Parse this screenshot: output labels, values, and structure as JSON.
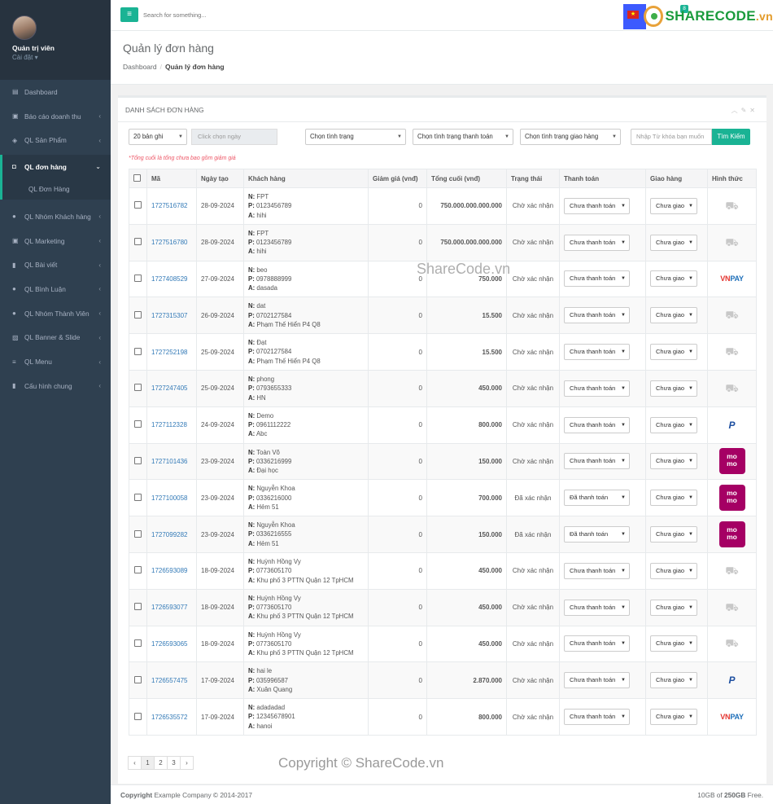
{
  "user": {
    "name": "Quản trị viên",
    "settings_label": "Cài đặt"
  },
  "sidebar": {
    "items": [
      {
        "icon": "table-icon",
        "label": "Dashboard"
      },
      {
        "icon": "money-icon",
        "label": "Báo cáo doanh thu"
      },
      {
        "icon": "cube-icon",
        "label": "QL Sản Phẩm"
      },
      {
        "icon": "shopping-bag-icon",
        "label": "QL đơn hàng"
      },
      {
        "icon": "user-icon",
        "label": "QL Nhóm Khách hàng"
      },
      {
        "icon": "money-icon",
        "label": "QL Marketing"
      },
      {
        "icon": "file-icon",
        "label": "QL Bài viết"
      },
      {
        "icon": "comment-icon",
        "label": "QL Bình Luận"
      },
      {
        "icon": "user-icon",
        "label": "QL Nhóm Thành Viên"
      },
      {
        "icon": "image-icon",
        "label": "QL Banner & Slide"
      },
      {
        "icon": "bars-icon",
        "label": "QL Menu"
      },
      {
        "icon": "file-icon",
        "label": "Cấu hình chung"
      }
    ],
    "sub_item": "QL Đơn Hàng"
  },
  "topbar": {
    "search_placeholder": "Search for something...",
    "notif_count": "8",
    "brand_a": "SHARE",
    "brand_b": "CODE",
    "brand_c": ".vn"
  },
  "page": {
    "title": "Quản lý đơn hàng",
    "crumb_home": "Dashboard",
    "crumb_current": "Quản lý đơn hàng"
  },
  "panel": {
    "title": "DANH SÁCH ĐƠN HÀNG"
  },
  "filters": {
    "page_size": "20 bản ghi",
    "date_placeholder": "Click chọn ngày",
    "status": "Chọn tình trạng",
    "pay_status": "Chọn tình trạng thanh toán",
    "ship_status": "Chọn tình trạng giao hàng",
    "keyword_placeholder": "Nhập Từ khóa bạn muốn",
    "search_button": "Tìm Kiếm"
  },
  "note": "*Tổng cuối là tổng chưa bao gồm giảm giá",
  "columns": [
    "Mã",
    "Ngày tạo",
    "Khách hàng",
    "Giảm giá (vnđ)",
    "Tổng cuối (vnđ)",
    "Trạng thái",
    "Thanh toán",
    "Giao hàng",
    "Hình thức"
  ],
  "orders": [
    {
      "code": "1727516782",
      "date": "28-09-2024",
      "name": "FPT",
      "phone": "0123456789",
      "addr": "hihi",
      "discount": "0",
      "total": "750.000.000.000.000",
      "status": "Chờ xác nhận",
      "pay": "Chưa thanh toán",
      "ship": "Chưa giao",
      "method": "truck"
    },
    {
      "code": "1727516780",
      "date": "28-09-2024",
      "name": "FPT",
      "phone": "0123456789",
      "addr": "hihi",
      "discount": "0",
      "total": "750.000.000.000.000",
      "status": "Chờ xác nhận",
      "pay": "Chưa thanh toán",
      "ship": "Chưa giao",
      "method": "truck"
    },
    {
      "code": "1727408529",
      "date": "27-09-2024",
      "name": "beo",
      "phone": "0978888999",
      "addr": "dasada",
      "discount": "0",
      "total": "750.000",
      "status": "Chờ xác nhận",
      "pay": "Chưa thanh toán",
      "ship": "Chưa giao",
      "method": "vnpay"
    },
    {
      "code": "1727315307",
      "date": "26-09-2024",
      "name": "dat",
      "phone": "0702127584",
      "addr": "Phạm Thế Hiển P4 Q8",
      "discount": "0",
      "total": "15.500",
      "status": "Chờ xác nhận",
      "pay": "Chưa thanh toán",
      "ship": "Chưa giao",
      "method": "truck"
    },
    {
      "code": "1727252198",
      "date": "25-09-2024",
      "name": "Đạt",
      "phone": "0702127584",
      "addr": "Phạm Thế Hiển P4 Q8",
      "discount": "0",
      "total": "15.500",
      "status": "Chờ xác nhận",
      "pay": "Chưa thanh toán",
      "ship": "Chưa giao",
      "method": "truck"
    },
    {
      "code": "1727247405",
      "date": "25-09-2024",
      "name": "phong",
      "phone": "0793655333",
      "addr": "HN",
      "discount": "0",
      "total": "450.000",
      "status": "Chờ xác nhận",
      "pay": "Chưa thanh toán",
      "ship": "Chưa giao",
      "method": "truck"
    },
    {
      "code": "1727112328",
      "date": "24-09-2024",
      "name": "Demo",
      "phone": "0961112222",
      "addr": "Abc",
      "discount": "0",
      "total": "800.000",
      "status": "Chờ xác nhận",
      "pay": "Chưa thanh toán",
      "ship": "Chưa giao",
      "method": "paypal"
    },
    {
      "code": "1727101436",
      "date": "23-09-2024",
      "name": "Toàn Võ",
      "phone": "0336216999",
      "addr": "Đại học",
      "discount": "0",
      "total": "150.000",
      "status": "Chờ xác nhận",
      "pay": "Chưa thanh toán",
      "ship": "Chưa giao",
      "method": "momo"
    },
    {
      "code": "1727100058",
      "date": "23-09-2024",
      "name": "Nguyễn Khoa",
      "phone": "0336216000",
      "addr": "Hẻm 51",
      "discount": "0",
      "total": "700.000",
      "status": "Đã xác nhận",
      "pay": "Đã thanh toán",
      "ship": "Chưa giao",
      "method": "momo"
    },
    {
      "code": "1727099282",
      "date": "23-09-2024",
      "name": "Nguyễn Khoa",
      "phone": "0336216555",
      "addr": "Hẻm 51",
      "discount": "0",
      "total": "150.000",
      "status": "Đã xác nhận",
      "pay": "Đã thanh toán",
      "ship": "Chưa giao",
      "method": "momo"
    },
    {
      "code": "1726593089",
      "date": "18-09-2024",
      "name": "Huỳnh Hồng Vy",
      "phone": "0773605170",
      "addr": "Khu phố 3 PTTN Quận 12 TpHCM",
      "discount": "0",
      "total": "450.000",
      "status": "Chờ xác nhận",
      "pay": "Chưa thanh toán",
      "ship": "Chưa giao",
      "method": "truck"
    },
    {
      "code": "1726593077",
      "date": "18-09-2024",
      "name": "Huỳnh Hồng Vy",
      "phone": "0773605170",
      "addr": "Khu phố 3 PTTN Quận 12 TpHCM",
      "discount": "0",
      "total": "450.000",
      "status": "Chờ xác nhận",
      "pay": "Chưa thanh toán",
      "ship": "Chưa giao",
      "method": "truck"
    },
    {
      "code": "1726593065",
      "date": "18-09-2024",
      "name": "Huỳnh Hồng Vy",
      "phone": "0773605170",
      "addr": "Khu phố 3 PTTN Quận 12 TpHCM",
      "discount": "0",
      "total": "450.000",
      "status": "Chờ xác nhận",
      "pay": "Chưa thanh toán",
      "ship": "Chưa giao",
      "method": "truck"
    },
    {
      "code": "1726557475",
      "date": "17-09-2024",
      "name": "hai le",
      "phone": "035996587",
      "addr": "Xuân Quang",
      "discount": "0",
      "total": "2.870.000",
      "status": "Chờ xác nhận",
      "pay": "Chưa thanh toán",
      "ship": "Chưa giao",
      "method": "paypal"
    },
    {
      "code": "1726535572",
      "date": "17-09-2024",
      "name": "adadadad",
      "phone": "12345678901",
      "addr": "hanoi",
      "discount": "0",
      "total": "800.000",
      "status": "Chờ xác nhận",
      "pay": "Chưa thanh toán",
      "ship": "Chưa giao",
      "method": "vnpay"
    }
  ],
  "cust_labels": {
    "name": "N:",
    "phone": "P:",
    "addr": "A:"
  },
  "pagination": [
    "‹",
    "1",
    "2",
    "3",
    "›"
  ],
  "watermarks": {
    "center": "ShareCode.vn",
    "bottom": "Copyright © ShareCode.vn"
  },
  "footer": {
    "left_bold": "Copyright",
    "left": "Example Company © 2014-2017",
    "right_pre": "10GB of ",
    "right_bold": "250GB",
    "right_post": " Free."
  }
}
